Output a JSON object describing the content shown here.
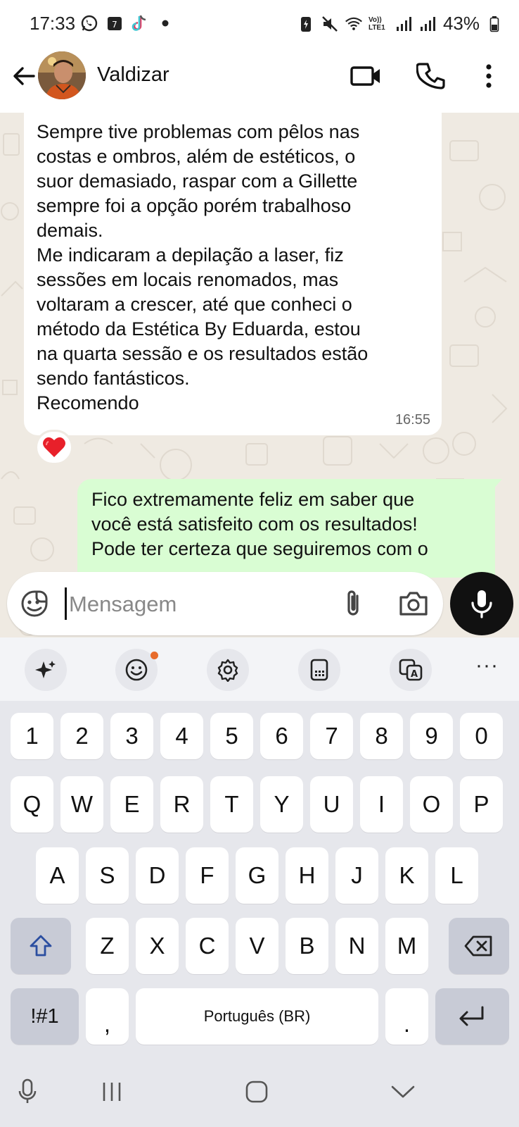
{
  "status_bar": {
    "time": "17:33",
    "battery": "43%",
    "network_label": "Vo)) LTE1"
  },
  "header": {
    "contact_name": "Valdizar"
  },
  "messages": [
    {
      "direction": "incoming",
      "text": "Sempre tive problemas com pêlos nas\ncostas e ombros, além de estéticos, o\nsuor demasiado, raspar com a Gillette\nsempre foi a opção porém trabalhoso\ndemais.\nMe indicaram a depilação a laser, fiz\nsessões em locais renomados, mas\nvoltaram a crescer, até que conheci o\nmétodo da Estética By Eduarda, estou\nna quarta sessão e os resultados estão\nsendo fantásticos.\nRecomendo",
      "time": "16:55",
      "reaction": "heart"
    },
    {
      "direction": "outgoing",
      "text": "Fico extremamente feliz em saber que\nvocê está satisfeito com os resultados!\nPode ter certeza que seguiremos com o"
    }
  ],
  "composer": {
    "placeholder": "Mensagem"
  },
  "keyboard": {
    "number_row": [
      "1",
      "2",
      "3",
      "4",
      "5",
      "6",
      "7",
      "8",
      "9",
      "0"
    ],
    "row1": [
      "Q",
      "W",
      "E",
      "R",
      "T",
      "Y",
      "U",
      "I",
      "O",
      "P"
    ],
    "row2": [
      "A",
      "S",
      "D",
      "F",
      "G",
      "H",
      "J",
      "K",
      "L"
    ],
    "row3": [
      "Z",
      "X",
      "C",
      "V",
      "B",
      "N",
      "M"
    ],
    "symbols_label": "!#1",
    "comma": ",",
    "space_label": "Português (BR)",
    "period": ".",
    "toolbar_more": "···"
  },
  "colors": {
    "chat_background": "#efeae2",
    "outgoing_bubble": "#d9fdd3",
    "incoming_bubble": "#ffffff",
    "mic_button": "#111111",
    "notification_dot": "#e76b2b"
  }
}
